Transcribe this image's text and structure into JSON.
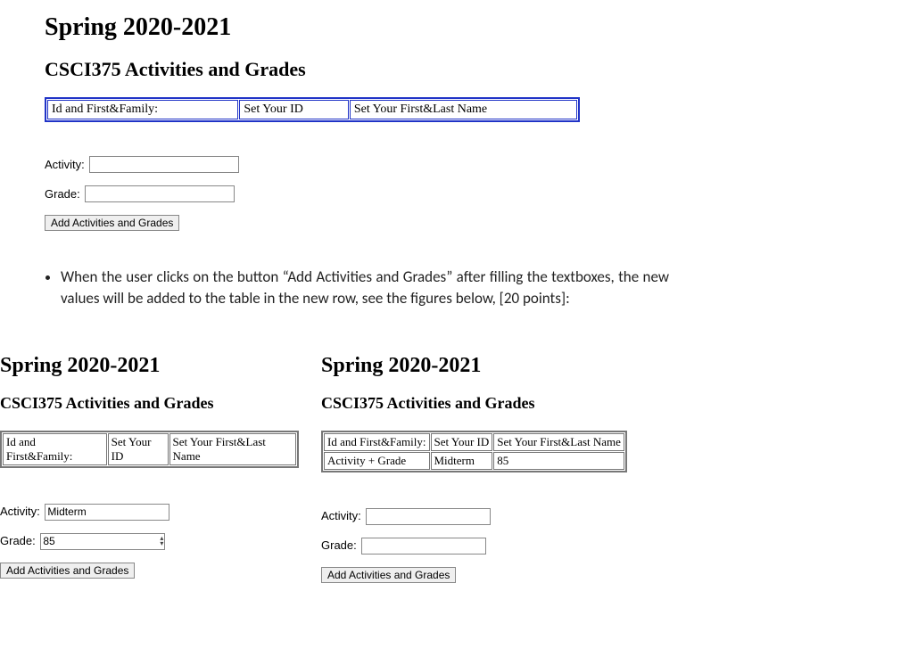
{
  "main": {
    "heading": "Spring 2020-2021",
    "subheading": "CSCI375 Activities and Grades",
    "table": {
      "col1": "Id and First&Family:",
      "col2": "Set Your ID",
      "col3": "Set Your First&Last Name"
    },
    "form": {
      "activity_label": "Activity:",
      "activity_value": "",
      "grade_label": "Grade:",
      "grade_value": "",
      "button": "Add Activities and Grades"
    }
  },
  "bullet_text": "When the user clicks on the button “Add Activities and Grades” after filling the textboxes, the new values  will be added to the table in the new row, see the figures below, [20 points]:",
  "example_left": {
    "heading": "Spring 2020-2021",
    "subheading": "CSCI375 Activities and Grades",
    "table": {
      "col1": "Id and First&Family:",
      "col2": "Set Your ID",
      "col3": "Set Your First&Last Name"
    },
    "form": {
      "activity_label": "Activity:",
      "activity_value": "Midterm",
      "grade_label": "Grade:",
      "grade_value": "85",
      "button": "Add Activities and Grades"
    }
  },
  "example_right": {
    "heading": "Spring 2020-2021",
    "subheading": "CSCI375 Activities and Grades",
    "table": {
      "row1": {
        "col1": "Id and First&Family:",
        "col2": "Set Your ID",
        "col3": "Set Your First&Last Name"
      },
      "row2": {
        "col1": "Activity + Grade",
        "col2": "Midterm",
        "col3": "85"
      }
    },
    "form": {
      "activity_label": "Activity:",
      "activity_value": "",
      "grade_label": "Grade:",
      "grade_value": "",
      "button": "Add Activities and Grades"
    }
  }
}
